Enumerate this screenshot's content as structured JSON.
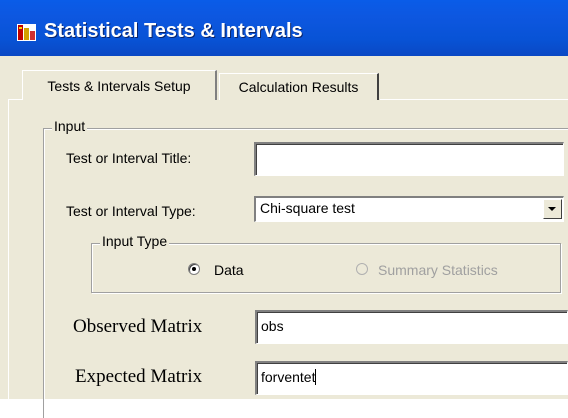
{
  "window": {
    "title": "Statistical Tests & Intervals",
    "icon": "app-icon"
  },
  "tabs": [
    {
      "label": "Tests & Intervals Setup",
      "active": true
    },
    {
      "label": "Calculation Results",
      "active": false
    }
  ],
  "input_group": {
    "legend": "Input",
    "title_label": "Test or Interval Title:",
    "title_value": "",
    "type_label": "Test or Interval Type:",
    "type_value": "Chi-square test",
    "type_dropdown_icon": "chevron-down-icon"
  },
  "input_type_group": {
    "legend": "Input Type",
    "options": [
      {
        "label": "Data",
        "selected": true,
        "enabled": true
      },
      {
        "label": "Summary Statistics",
        "selected": false,
        "enabled": false
      }
    ]
  },
  "matrices": {
    "observed_label": "Observed Matrix",
    "observed_value": "obs",
    "expected_label": "Expected Matrix",
    "expected_value": "forventet"
  },
  "colors": {
    "titlebar": "#0a5ce8",
    "face": "#ece9d8",
    "disabled_text": "#a0a0a0"
  }
}
